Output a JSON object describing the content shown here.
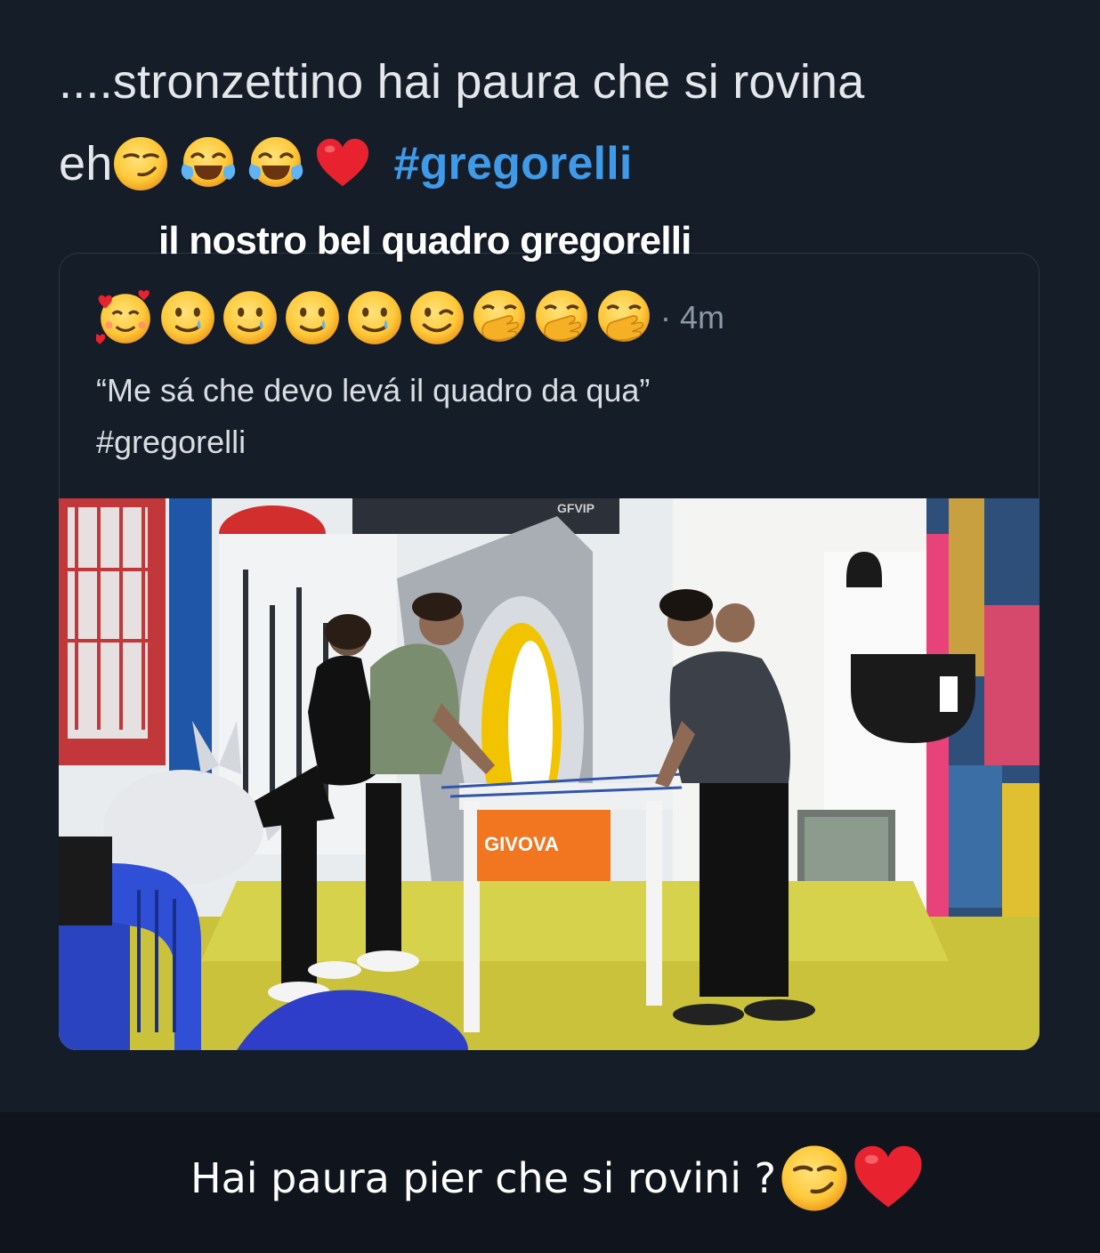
{
  "story_text": {
    "line1": "....stronzettino hai paura che si rovina",
    "line2_text": "eh",
    "line2_icons": [
      "smirk-emoji",
      "tears-of-joy-emoji",
      "tears-of-joy-emoji",
      "red-heart-emoji"
    ],
    "hashtag": "#gregorelli"
  },
  "story_caption": "il nostro bel quadro gregorelli",
  "tweet": {
    "header_icons": [
      "smiling-face-with-hearts-emoji",
      "smiling-tear-emoji",
      "smiling-tear-emoji",
      "smiling-tear-emoji",
      "smiling-tear-emoji",
      "winking-face-emoji",
      "hand-over-mouth-emoji",
      "hand-over-mouth-emoji",
      "hand-over-mouth-emoji"
    ],
    "timestamp": "· 4m",
    "text_line1": "“Me sá che devo levá il quadro da qua”",
    "text_line2": "#gregorelli",
    "media": {
      "watermark": "GFVIP",
      "table_brand": "GIVOVA"
    }
  },
  "bottom_caption": {
    "text": "Hai paura pier che si rovini ?",
    "icons": [
      "smirk-emoji",
      "red-heart-emoji"
    ]
  },
  "colors": {
    "background": "#151d29",
    "hashtag": "#3f9ae8",
    "timestamp": "#8b98a5",
    "bottom_bar": "#10151d"
  }
}
